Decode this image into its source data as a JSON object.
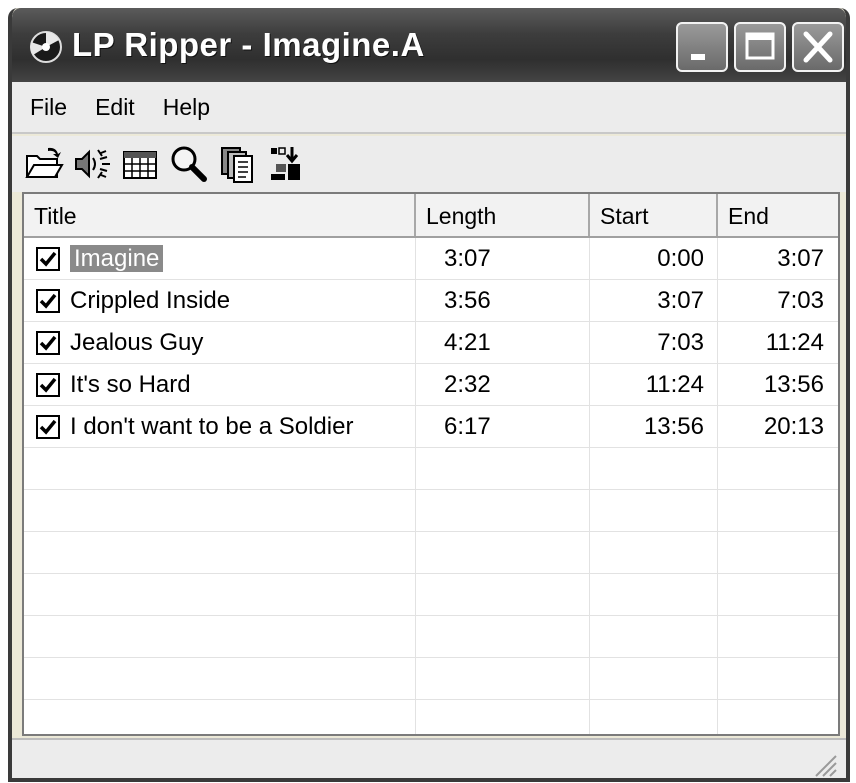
{
  "window": {
    "title": "LP Ripper - Imagine.A",
    "icon": "lp-record-icon"
  },
  "titlebar_buttons": {
    "minimize": "minimize-icon",
    "maximize": "maximize-icon",
    "close": "close-icon"
  },
  "menu": {
    "items": [
      {
        "label": "File"
      },
      {
        "label": "Edit"
      },
      {
        "label": "Help"
      }
    ]
  },
  "toolbar": {
    "tools": [
      {
        "icon": "open-folder-icon"
      },
      {
        "icon": "record-speaker-icon"
      },
      {
        "icon": "grid-table-icon"
      },
      {
        "icon": "magnifier-icon"
      },
      {
        "icon": "copy-pages-icon"
      },
      {
        "icon": "split-tracks-icon"
      }
    ]
  },
  "table": {
    "columns": [
      "Title",
      "Length",
      "Start",
      "End"
    ],
    "rows": [
      {
        "checked": true,
        "title": "Imagine",
        "length": "3:07",
        "start": "0:00",
        "end": "3:07",
        "selected": true
      },
      {
        "checked": true,
        "title": "Crippled Inside",
        "length": "3:56",
        "start": "3:07",
        "end": "7:03",
        "selected": false
      },
      {
        "checked": true,
        "title": "Jealous Guy",
        "length": "4:21",
        "start": "7:03",
        "end": "11:24",
        "selected": false
      },
      {
        "checked": true,
        "title": "It's so Hard",
        "length": "2:32",
        "start": "11:24",
        "end": "13:56",
        "selected": false
      },
      {
        "checked": true,
        "title": "I don't want to be a Soldier",
        "length": "6:17",
        "start": "13:56",
        "end": "20:13",
        "selected": false
      }
    ]
  },
  "colors": {
    "titlebar": "#3d3d3d",
    "window_bg": "#ececec",
    "selection": "#8a8a8a"
  }
}
